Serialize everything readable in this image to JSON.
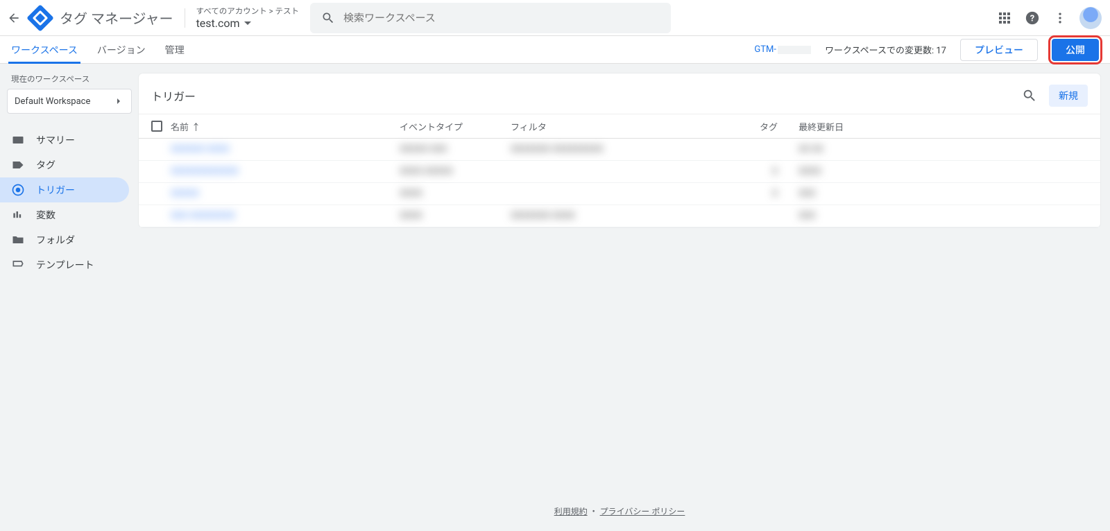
{
  "header": {
    "app_title": "タグ マネージャー",
    "account_path": "すべてのアカウント > テスト",
    "account_name": "test.com",
    "search_placeholder": "検索ワークスペース"
  },
  "subheader": {
    "tabs": {
      "workspace": "ワークスペース",
      "version": "バージョン",
      "admin": "管理"
    },
    "gtm_prefix": "GTM-",
    "changes_label": "ワークスペースでの変更数: 17",
    "preview": "プレビュー",
    "publish": "公開"
  },
  "sidebar": {
    "ws_label": "現在のワークスペース",
    "ws_name": "Default Workspace",
    "items": {
      "summary": "サマリー",
      "tags": "タグ",
      "triggers": "トリガー",
      "variables": "変数",
      "folders": "フォルダ",
      "templates": "テンプレート"
    }
  },
  "main": {
    "title": "トリガー",
    "new": "新規",
    "columns": {
      "name": "名前",
      "event": "イベントタイプ",
      "filter": "フィルタ",
      "tag": "タグ",
      "date": "最終更新日"
    },
    "rows": [
      {
        "name": "XXXXXX XXXX",
        "event": "XXXXX XXX",
        "filter": "XXXXXXX XXXXXXXXX",
        "tag": "",
        "date": "XX XX"
      },
      {
        "name": "XXXXXXXXXXXX",
        "event": "XXXX XXXXX",
        "filter": "",
        "tag": "X",
        "date": "XXXX"
      },
      {
        "name": "XXXXX",
        "event": "XXXX",
        "filter": "",
        "tag": "X",
        "date": "XXX"
      },
      {
        "name": "XXX XXXXXXXX",
        "event": "XXXX",
        "filter": "XXXXXXX XXXX",
        "tag": "",
        "date": "XXX"
      }
    ]
  },
  "footer": {
    "terms": "利用規約",
    "sep": " ・ ",
    "privacy": "プライバシー ポリシー"
  }
}
